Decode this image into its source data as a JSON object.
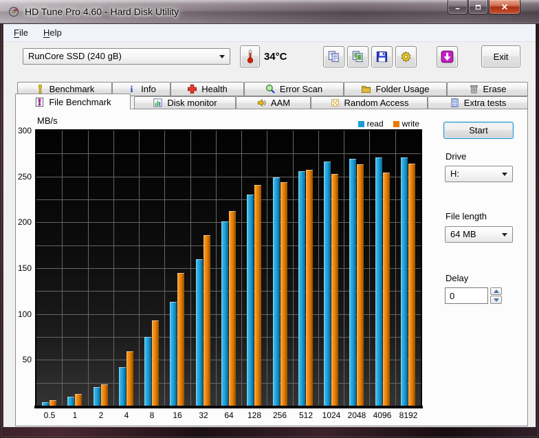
{
  "window": {
    "title": "HD Tune Pro 4.60 - Hard Disk Utility",
    "app_icon": "disk-icon",
    "buttons": [
      {
        "name": "minimize-button",
        "icon": "minimize-icon"
      },
      {
        "name": "maximize-button",
        "icon": "maximize-icon"
      },
      {
        "name": "close-button",
        "icon": "close-icon"
      }
    ]
  },
  "menu": {
    "items": [
      {
        "label": "File"
      },
      {
        "label": "Help"
      }
    ]
  },
  "toolbar": {
    "device_select": {
      "value": "RunCore SSD (240 gB)"
    },
    "temperature": "34°C",
    "temperature_icon": "thermometer-icon",
    "buttons": [
      {
        "name": "copy-text-button",
        "icon": "copy-text-icon"
      },
      {
        "name": "copy-image-button",
        "icon": "copy-image-icon"
      },
      {
        "name": "save-button",
        "icon": "save-icon"
      },
      {
        "name": "settings-button",
        "icon": "settings-icon"
      },
      {
        "name": "download-button",
        "icon": "download-icon"
      }
    ],
    "exit_label": "Exit"
  },
  "tabs": {
    "row1": [
      {
        "label": "Benchmark",
        "icon": "benchmark-icon"
      },
      {
        "label": "Info",
        "icon": "info-icon"
      },
      {
        "label": "Health",
        "icon": "health-icon"
      },
      {
        "label": "Error Scan",
        "icon": "error-scan-icon"
      },
      {
        "label": "Folder Usage",
        "icon": "folder-usage-icon"
      },
      {
        "label": "Erase",
        "icon": "erase-icon"
      }
    ],
    "row2": [
      {
        "label": "File Benchmark",
        "icon": "file-benchmark-icon",
        "active": true
      },
      {
        "label": "Disk monitor",
        "icon": "disk-monitor-icon"
      },
      {
        "label": "AAM",
        "icon": "aam-icon"
      },
      {
        "label": "Random Access",
        "icon": "random-access-icon"
      },
      {
        "label": "Extra tests",
        "icon": "extra-tests-icon"
      }
    ]
  },
  "controls": {
    "start_label": "Start",
    "drive": {
      "label": "Drive",
      "value": "H:"
    },
    "file_length": {
      "label": "File length",
      "value": "64 MB"
    },
    "delay": {
      "label": "Delay",
      "value": "0"
    }
  },
  "chart_data": {
    "type": "bar",
    "ylabel": "MB/s",
    "categories": [
      "0.5",
      "1",
      "2",
      "4",
      "8",
      "16",
      "32",
      "64",
      "128",
      "256",
      "512",
      "1024",
      "2048",
      "4096",
      "8192"
    ],
    "series": [
      {
        "name": "read",
        "color": "#1B9ED6",
        "values": [
          4,
          10,
          20,
          42,
          75,
          113,
          160,
          201,
          230,
          249,
          256,
          266,
          269,
          271,
          271
        ]
      },
      {
        "name": "write",
        "color": "#E57D00",
        "values": [
          6,
          13,
          23,
          59,
          93,
          145,
          186,
          212,
          241,
          244,
          257,
          253,
          263,
          254,
          264
        ]
      }
    ],
    "ylim": [
      0,
      300
    ],
    "yticks": [
      50,
      100,
      150,
      200,
      250,
      300
    ],
    "ytick_step": 50,
    "grid_step": 25,
    "grid": true,
    "legend_position": "top-right",
    "plot_background": "#000000",
    "gridline_color": "#666666"
  }
}
